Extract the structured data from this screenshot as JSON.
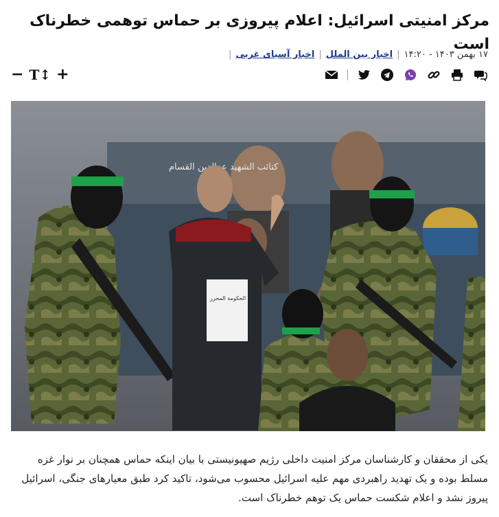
{
  "article": {
    "title": "مرکز امنیتی اسرائیل: اعلام پیروزی بر حماس توهمی خطرناک است",
    "datetime": "۱۷ بهمن ۱۴۰۳ - ۱۴:۲۰",
    "categories": [
      "اخبار بین الملل",
      "اخبار آسیای غربی"
    ],
    "lead": "یکی از محققان و کارشناسان مرکز امنیت داخلی رژیم صهیونیستی با بیان اینکه حماس همچنان بر نوار غزه مسلط بوده و یک تهدید راهبردی مهم علیه اسرائیل محسوب می‌شود، تاکید کرد طبق معیارهای جنگی، اسرائیل پیروز نشد و اعلام شکست حماس یک توهم خطرناک است."
  },
  "photo": {
    "banner_text": "کتائب الشهید عزالدین القسام",
    "certificate_title": "الحکومة المحرر"
  },
  "toolbar": {
    "share_icons": [
      "comments-icon",
      "print-icon",
      "link-icon",
      "whatsapp-icon",
      "telegram-icon",
      "twitter-icon",
      "email-icon"
    ],
    "font_increase": "+",
    "font_label": "T↕",
    "font_decrease": "−"
  },
  "colors": {
    "link": "#1f3b8c",
    "headband": "#1fa04a",
    "camo": "#4a5a2e"
  }
}
